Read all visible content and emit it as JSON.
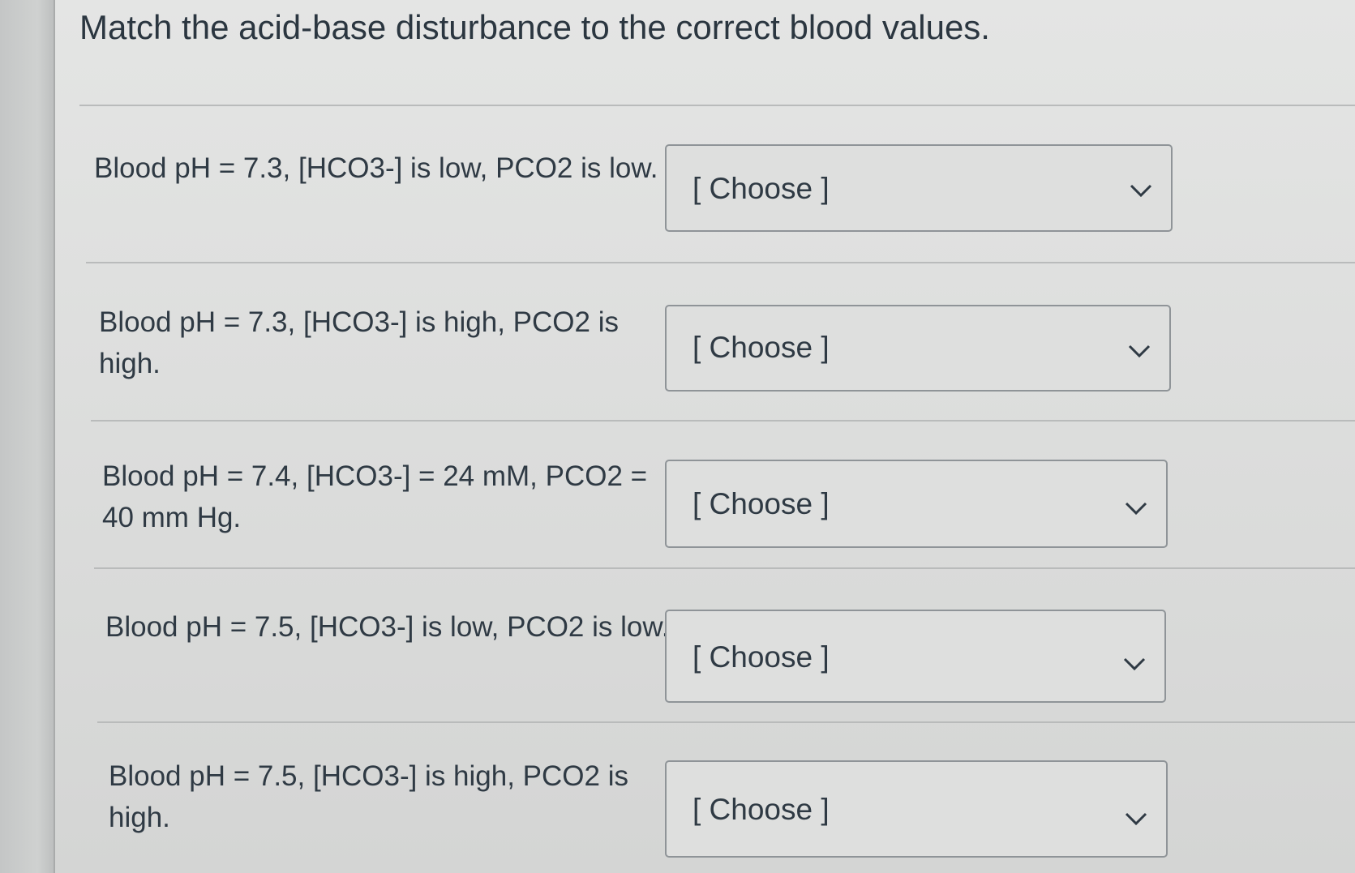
{
  "question": {
    "title": "Match the acid-base disturbance to the correct blood values."
  },
  "rows": [
    {
      "label": "Blood pH = 7.3, [HCO3-] is low, PCO2 is low.",
      "select_value": "[ Choose ]",
      "chevron_icon": "chevron-down-icon"
    },
    {
      "label": "Blood pH = 7.3, [HCO3-] is high, PCO2 is high.",
      "select_value": "[ Choose ]",
      "chevron_icon": "chevron-down-icon"
    },
    {
      "label": "Blood pH = 7.4, [HCO3-] = 24 mM, PCO2 = 40 mm Hg.",
      "select_value": "[ Choose ]",
      "chevron_icon": "chevron-down-icon"
    },
    {
      "label": "Blood pH = 7.5, [HCO3-] is low, PCO2 is low.",
      "select_value": "[ Choose ]",
      "chevron_icon": "chevron-down-icon"
    },
    {
      "label": "Blood pH = 7.5, [HCO3-] is high, PCO2 is high.",
      "select_value": "[ Choose ]",
      "chevron_icon": "chevron-down-icon"
    }
  ]
}
